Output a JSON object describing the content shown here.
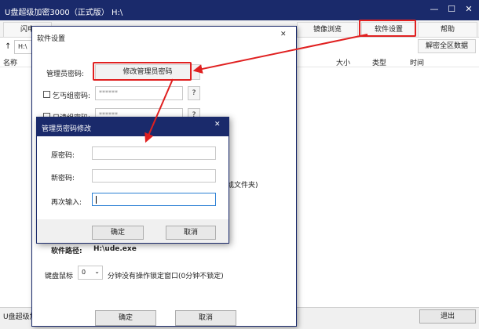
{
  "window": {
    "title": "U盘超级加密3000（正式版）  H:\\",
    "min_icon": "—",
    "max_icon": "☐",
    "close_icon": "✕"
  },
  "toolbar": {
    "items": [
      "闪电",
      "镜像浏览",
      "软件设置",
      "帮助"
    ]
  },
  "address": {
    "up_icon": "↑",
    "path": "H:\\",
    "decrypt_all": "解密全区数据"
  },
  "list": {
    "col_name": "名称",
    "col_size": "大小",
    "col_type": "类型",
    "col_time": "时间"
  },
  "status": {
    "left_text": "U盘超级加",
    "exit_label": "退出"
  },
  "settings_dialog": {
    "title": "软件设置",
    "admin_pwd_label": "管理员密码:",
    "modify_admin_btn": "修改管理员密码",
    "beggar_pwd_label": "乞丐组密码:",
    "beggar_pwd_value": "******",
    "help_q": "?",
    "browse_pwd_label": "只读组密码:",
    "browse_pwd_value": "******",
    "side_note": "或文件夹)",
    "soft_path_label": "软件路径:",
    "soft_path_value": "H:\\ude.exe",
    "keyboard_label": "键盘鼠标",
    "minutes_value": "0",
    "lock_text": "分钟没有操作锁定窗口(0分钟不锁定)",
    "ok": "确定",
    "cancel": "取消"
  },
  "admin_dialog": {
    "title": "管理员密码修改",
    "old_pwd": "原密码:",
    "new_pwd": "新密码:",
    "repeat_pwd": "再次输入:",
    "ok": "确定",
    "cancel": "取消"
  },
  "colors": {
    "title_bar": "#1a2a6b",
    "highlight": "#e02020",
    "focus": "#2a7fd4"
  }
}
